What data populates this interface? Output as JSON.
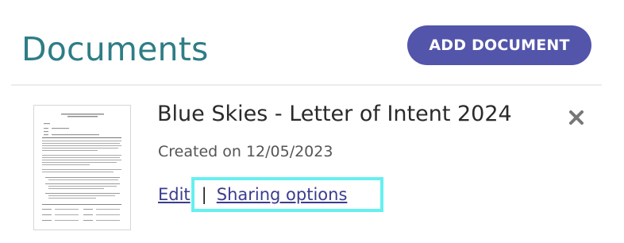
{
  "page": {
    "title": "Documents"
  },
  "header": {
    "add_button_label": "ADD DOCUMENT"
  },
  "document": {
    "title": "Blue Skies - Letter of Intent 2024",
    "created_text": "Created on 12/05/2023",
    "edit_label": "Edit",
    "separator": "|",
    "sharing_label": "Sharing options",
    "thumbnail_alt": "document-page-thumbnail"
  },
  "icons": {
    "close": "close-icon",
    "thumbnail": "document-thumbnail-icon"
  },
  "colors": {
    "title": "#2e7d86",
    "button_bg": "#5355ab",
    "link": "#3a3d8f",
    "highlight": "#66f0f0",
    "close": "#777777"
  }
}
